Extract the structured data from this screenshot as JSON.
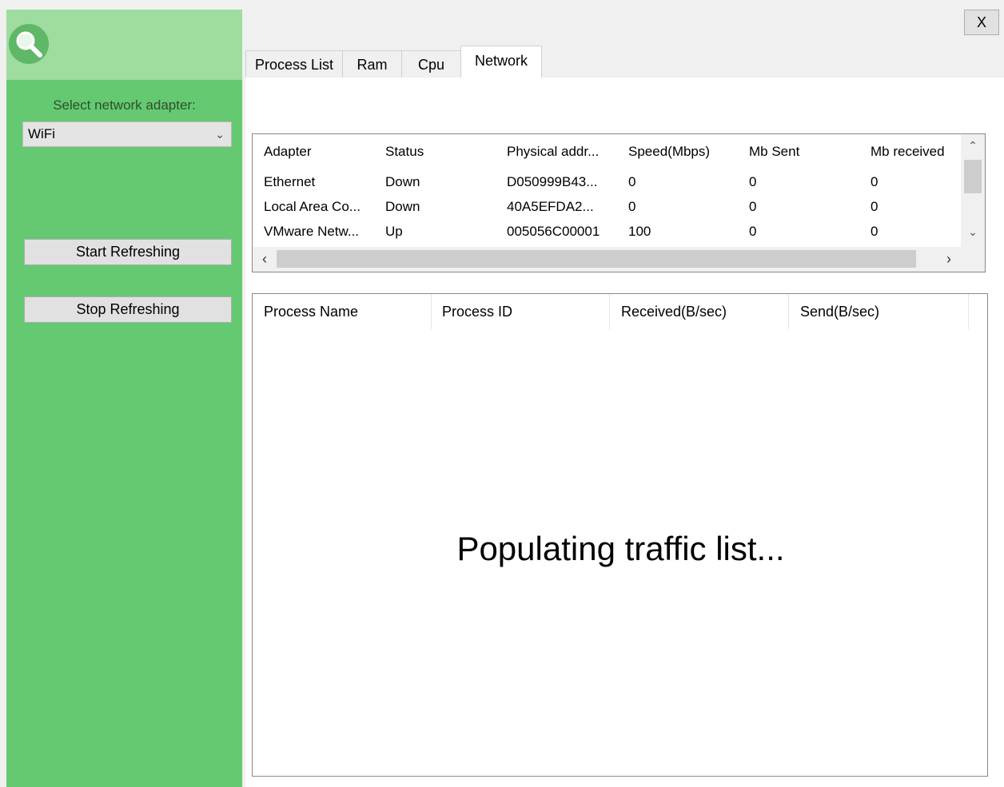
{
  "window": {
    "close_label": "X"
  },
  "sidebar": {
    "logo_icon": "search-icon",
    "adapter_label": "Select network adapter:",
    "adapter_selected": "WiFi",
    "start_button": "Start Refreshing",
    "stop_button": "Stop Refreshing",
    "colors": {
      "panel": "#64c970",
      "header": "#9fdc9f"
    }
  },
  "tabs": [
    {
      "label": "Process List"
    },
    {
      "label": "Ram"
    },
    {
      "label": "Cpu"
    },
    {
      "label": "Network",
      "active": true
    }
  ],
  "adapters": {
    "columns": [
      "Adapter",
      "Status",
      "Physical addr...",
      "Speed(Mbps)",
      "Mb Sent",
      "Mb received"
    ],
    "rows": [
      [
        "Ethernet",
        "Down",
        "D050999B43...",
        "0",
        "0",
        "0"
      ],
      [
        "Local Area Co...",
        "Down",
        "40A5EFDA2...",
        "0",
        "0",
        "0"
      ],
      [
        "VMware Netw...",
        "Up",
        "005056C00001",
        "100",
        "0",
        "0"
      ]
    ]
  },
  "traffic": {
    "columns": [
      "Process Name",
      "Process ID",
      "Received(B/sec)",
      "Send(B/sec)"
    ],
    "placeholder": "Populating traffic list..."
  }
}
